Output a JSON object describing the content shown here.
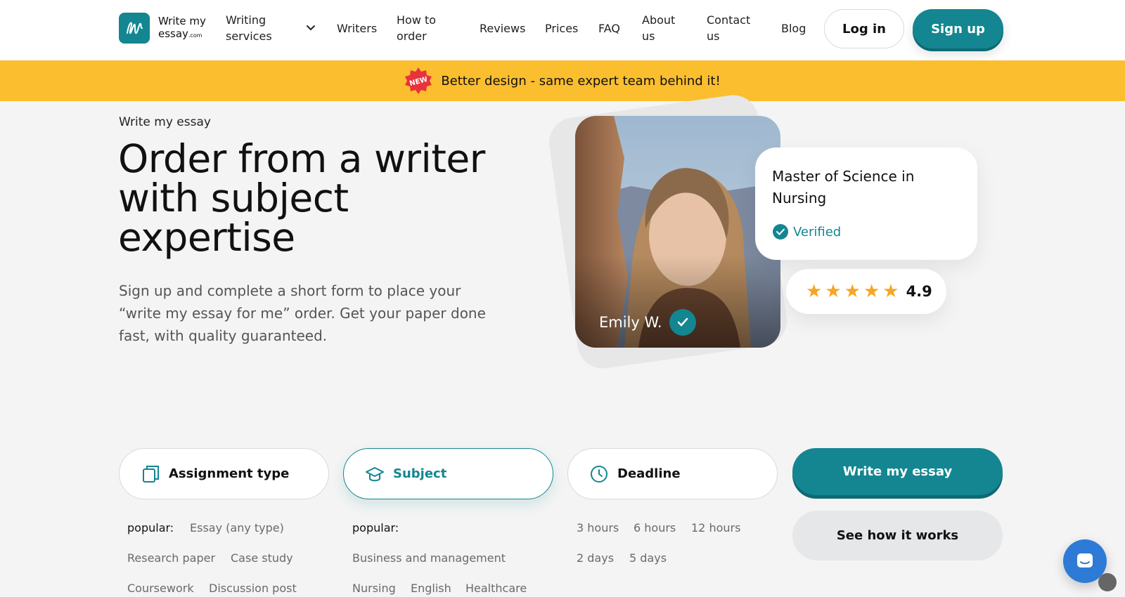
{
  "header": {
    "logo": {
      "line1": "Write my",
      "line2": "essay",
      "suffix": ".com"
    },
    "nav": [
      {
        "label": "Writing services"
      },
      {
        "label": "Writers"
      },
      {
        "label": "How to order"
      },
      {
        "label": "Reviews"
      },
      {
        "label": "Prices"
      },
      {
        "label": "FAQ"
      },
      {
        "label": "About us"
      },
      {
        "label": "Contact us"
      },
      {
        "label": "Blog"
      }
    ],
    "login_label": "Log in",
    "signup_label": "Sign up"
  },
  "banner": {
    "badge": "NEW",
    "text": "Better design - same expert team behind it!"
  },
  "hero": {
    "eyebrow": "Write my essay",
    "title": "Order from a writer with subject expertise",
    "subtitle": "Sign up and complete a short form to place your “write my essay for me” order. Get your paper done fast, with quality guaranteed."
  },
  "writer": {
    "name": "Emily W.",
    "degree": "Master of Science in Nursing",
    "verified_label": "Verified",
    "rating": "4.9",
    "stars": 5
  },
  "form": {
    "fields": [
      {
        "label": "Assignment type",
        "icon": "document-icon"
      },
      {
        "label": "Subject",
        "icon": "graduation-cap-icon",
        "active": true
      },
      {
        "label": "Deadline",
        "icon": "clock-icon"
      }
    ],
    "submit_label": "Write my essay",
    "how_label": "See how it works",
    "assignment_options": {
      "popular_label": "popular:",
      "items": [
        "Essay (any type)",
        "Research paper",
        "Case study",
        "Coursework",
        "Discussion post"
      ]
    },
    "subject_options": {
      "popular_label": "popular:",
      "items": [
        "Business and management",
        "Nursing",
        "English",
        "Healthcare"
      ]
    },
    "deadline_options": {
      "items": [
        "3 hours",
        "6 hours",
        "12 hours",
        "2 days",
        "5 days"
      ]
    }
  },
  "colors": {
    "brand": "#138691",
    "banner": "#fbbe2e",
    "star": "#f5a623",
    "chat": "#2d7bd6"
  }
}
